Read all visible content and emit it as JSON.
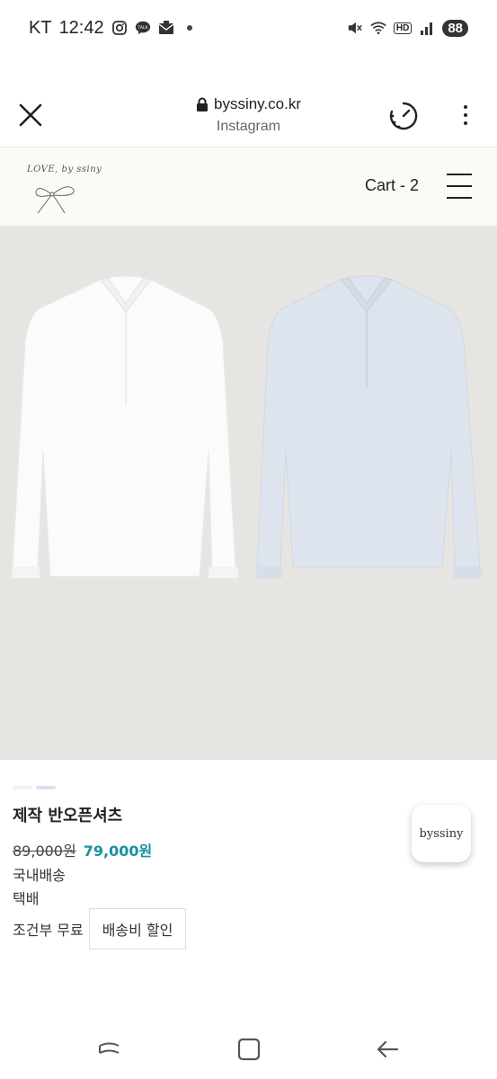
{
  "status_bar": {
    "carrier": "KT",
    "time": "12:42",
    "battery": "88",
    "hd_label": "HD"
  },
  "browser": {
    "url": "byssiny.co.kr",
    "source": "Instagram"
  },
  "site": {
    "logo_text": "LOVE, by ssiny",
    "cart_label": "Cart - 2"
  },
  "product": {
    "name": "제작 반오픈셔츠",
    "price_original": "89,000원",
    "price_sale": "79,000원",
    "shipping_region": "국내배송",
    "shipping_method": "택배",
    "shipping_condition": "조건부 무료",
    "shipping_discount_button": "배송비 할인",
    "brand_badge": "byssiny",
    "colors": {
      "accent_price": "#1a8fa3",
      "shirt_white": "#fbfbfb",
      "shirt_blue": "#dde4ee",
      "image_background": "#e6e5e1"
    }
  },
  "icons": {
    "close": "close-icon",
    "lock": "lock-icon",
    "timer": "timer-icon",
    "more": "more-vertical-icon",
    "menu": "hamburger-menu-icon",
    "recents": "recents-icon",
    "home": "home-icon",
    "back": "back-icon"
  }
}
